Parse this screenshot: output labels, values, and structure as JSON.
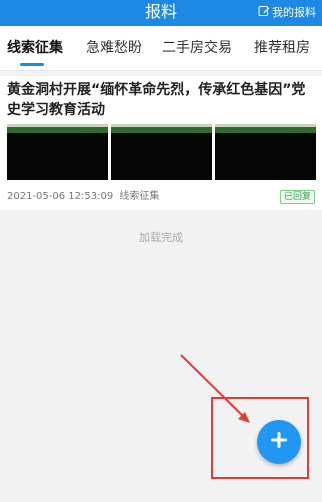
{
  "header": {
    "title": "报料",
    "my_report": "我的报料"
  },
  "tabs": [
    {
      "label": "线索征集",
      "active": true
    },
    {
      "label": "急难愁盼",
      "active": false
    },
    {
      "label": "二手房交易",
      "active": false
    },
    {
      "label": "推荐租房",
      "active": false
    }
  ],
  "post": {
    "title": "黄金洞村开展“缅怀革命先烈，传承红色基因”党史学习教育活动",
    "datetime": "2021-05-06 12:53:09",
    "category": "线索征集",
    "status": "已回复"
  },
  "feed_status": "加载完成",
  "icons": {
    "edit": "edit-icon",
    "add": "plus-icon"
  },
  "colors": {
    "brand": "#1e88e5",
    "fab": "#2196f3",
    "annotation": "#e53935",
    "status_green": "#3aa04a"
  }
}
